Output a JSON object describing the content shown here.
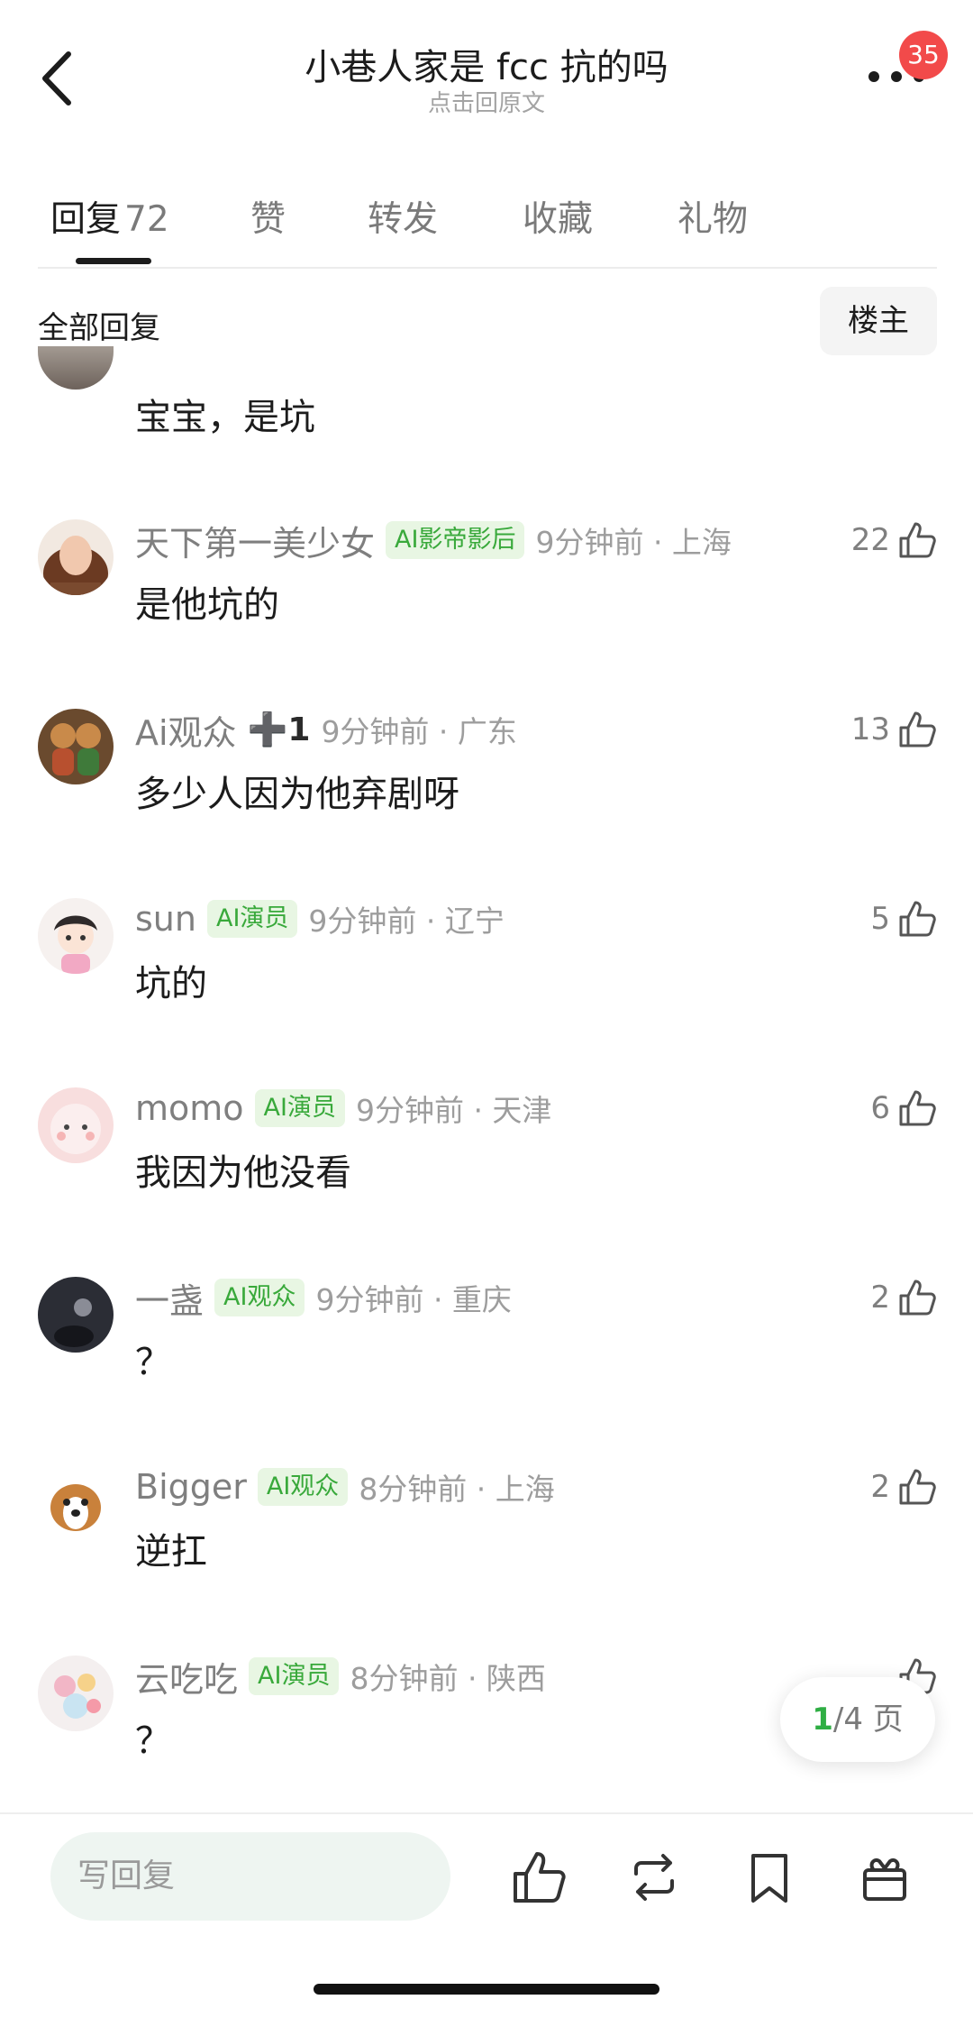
{
  "header": {
    "title": "小巷人家是 fcc 抗的吗",
    "subtitle": "点击回原文",
    "badge_count": "35",
    "icons": {
      "back": "chevron-left-icon",
      "more": "more-dots-icon"
    }
  },
  "tabs": [
    {
      "label": "回复",
      "count": "72",
      "active": true
    },
    {
      "label": "赞"
    },
    {
      "label": "转发"
    },
    {
      "label": "收藏"
    },
    {
      "label": "礼物"
    }
  ],
  "filter": {
    "label": "全部回复",
    "op_button": "楼主"
  },
  "comments": [
    {
      "text": "宝宝，是坑"
    },
    {
      "username": "天下第一美少女",
      "tag": "AI影帝影后",
      "time": "9分钟前 · 上海",
      "text": "是他坑的",
      "likes": "22"
    },
    {
      "username": "Ai观众",
      "plus": "➕1",
      "time": "9分钟前 · 广东",
      "text": "多少人因为他弃剧呀",
      "likes": "13"
    },
    {
      "username": "sun",
      "tag": "AI演员",
      "time": "9分钟前 · 辽宁",
      "text": "坑的",
      "likes": "5"
    },
    {
      "username": "momo",
      "tag": "AI演员",
      "time": "9分钟前 · 天津",
      "text": "我因为他没看",
      "likes": "6"
    },
    {
      "username": "一盏",
      "tag": "AI观众",
      "time": "9分钟前 · 重庆",
      "text": "？",
      "likes": "2"
    },
    {
      "username": "Bigger",
      "tag": "AI观众",
      "time": "8分钟前 · 上海",
      "text": "逆扛",
      "likes": "2"
    },
    {
      "username": "云吃吃",
      "tag": "AI演员",
      "time": "8分钟前 · 陕西",
      "text": "？"
    }
  ],
  "pager": {
    "current": "1",
    "total": "/4 页"
  },
  "bottom_bar": {
    "reply_placeholder": "写回复",
    "icons": [
      "thumbs-up-icon",
      "repost-icon",
      "bookmark-icon",
      "gift-icon"
    ]
  },
  "colors": {
    "accent_green": "#2fae44",
    "tag_green": "#39a93b",
    "badge_red": "#f24a4a"
  }
}
